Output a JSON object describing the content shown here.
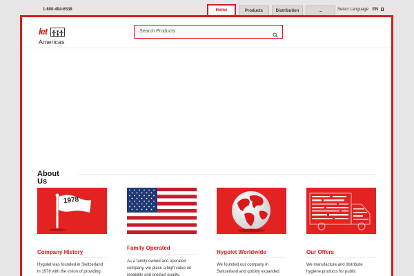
{
  "topbar": {
    "phone": "1-800-494-6538",
    "nav": [
      "Home",
      "Products",
      "Distribution",
      "..."
    ],
    "lang_label": "Select Language",
    "lang_value": "EN",
    "lang_icon": "dropdown-icon"
  },
  "header": {
    "logo_text": "let",
    "logo_sub": "Americas",
    "search_placeholder": "Search Products",
    "search_icon": "search-icon"
  },
  "about": {
    "title": "About Us",
    "cards": [
      {
        "title": "Company History",
        "text": "Hygolet was founded in Switzerland in 1978 with the vision of providing",
        "image_label": "1978",
        "image": "flag-1978"
      },
      {
        "title": "Family Operated",
        "text": "As a family owned and operated company, we place a high value on reliability and product quality.",
        "image": "us-flag"
      },
      {
        "title": "Hygolet Worldwide",
        "text": "We founded our company in Switzerland and quickly expanded",
        "image": "globe"
      },
      {
        "title": "Our Offers",
        "text": "We manufacture and distribute hygiene products for public",
        "image": "word-cloud-truck"
      }
    ]
  },
  "colors": {
    "accent": "#d91a1a",
    "background": "#e6e6e6"
  }
}
